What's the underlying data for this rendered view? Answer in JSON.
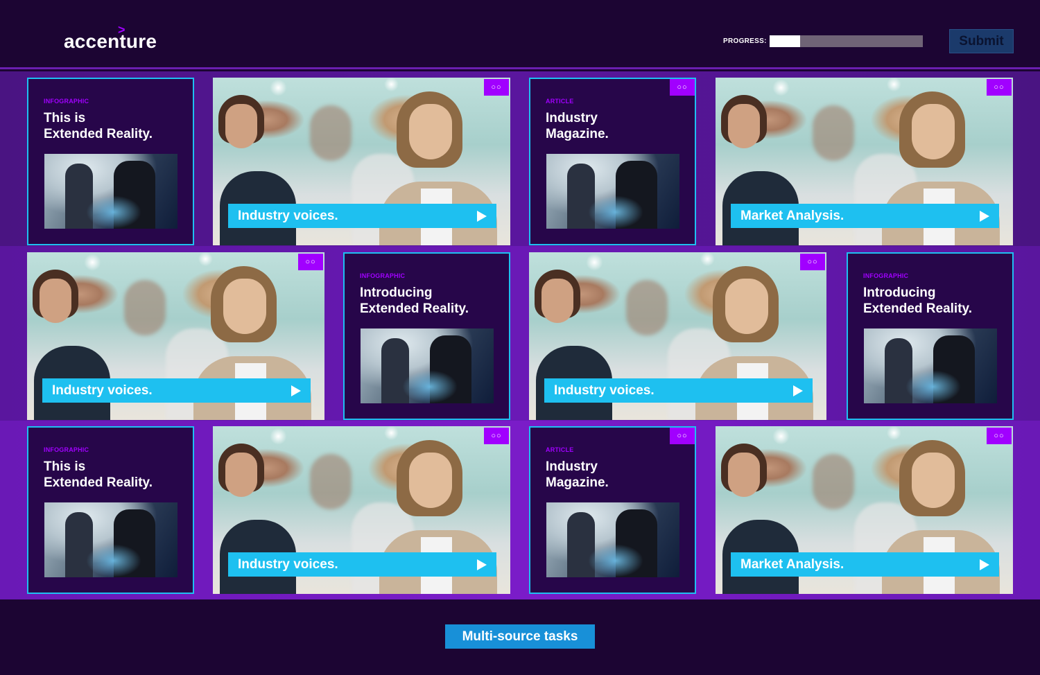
{
  "brand": {
    "name": "accenture",
    "mark": ">"
  },
  "progress": {
    "label": "PROGRESS:",
    "value": 0.2
  },
  "submit_label": "Submit",
  "tiles": {
    "r1c1": {
      "tag": "INFOGRAPHIC",
      "title": "This is\nExtended Reality."
    },
    "r1c2": {
      "dots": "○○",
      "cta": "Industry voices."
    },
    "r1c3": {
      "dots": "○○",
      "tag": "ARTICLE",
      "title": "Industry\nMagazine."
    },
    "r1c4": {
      "dots": "○○",
      "cta": "Market Analysis."
    },
    "r2c1": {
      "dots": "○○",
      "cta": "Industry voices."
    },
    "r2c2": {
      "tag": "INFOGRAPHIC",
      "title": "Introducing\nExtended Reality."
    },
    "r2c3": {
      "dots": "○○",
      "cta": "Industry voices."
    },
    "r2c4": {
      "tag": "INFOGRAPHIC",
      "title": "Introducing\nExtended Reality."
    },
    "r3c1": {
      "tag": "INFOGRAPHIC",
      "title": "This is\nExtended Reality."
    },
    "r3c2": {
      "dots": "○○",
      "cta": "Industry voices."
    },
    "r3c3": {
      "dots": "○○",
      "tag": "ARTICLE",
      "title": "Industry\nMagazine."
    },
    "r3c4": {
      "dots": "○○",
      "cta": "Market Analysis."
    }
  },
  "footer_button": "Multi-source tasks",
  "colors": {
    "background": "#1c0533",
    "accent": "#a100ff",
    "cta": "#1ec0f0"
  }
}
